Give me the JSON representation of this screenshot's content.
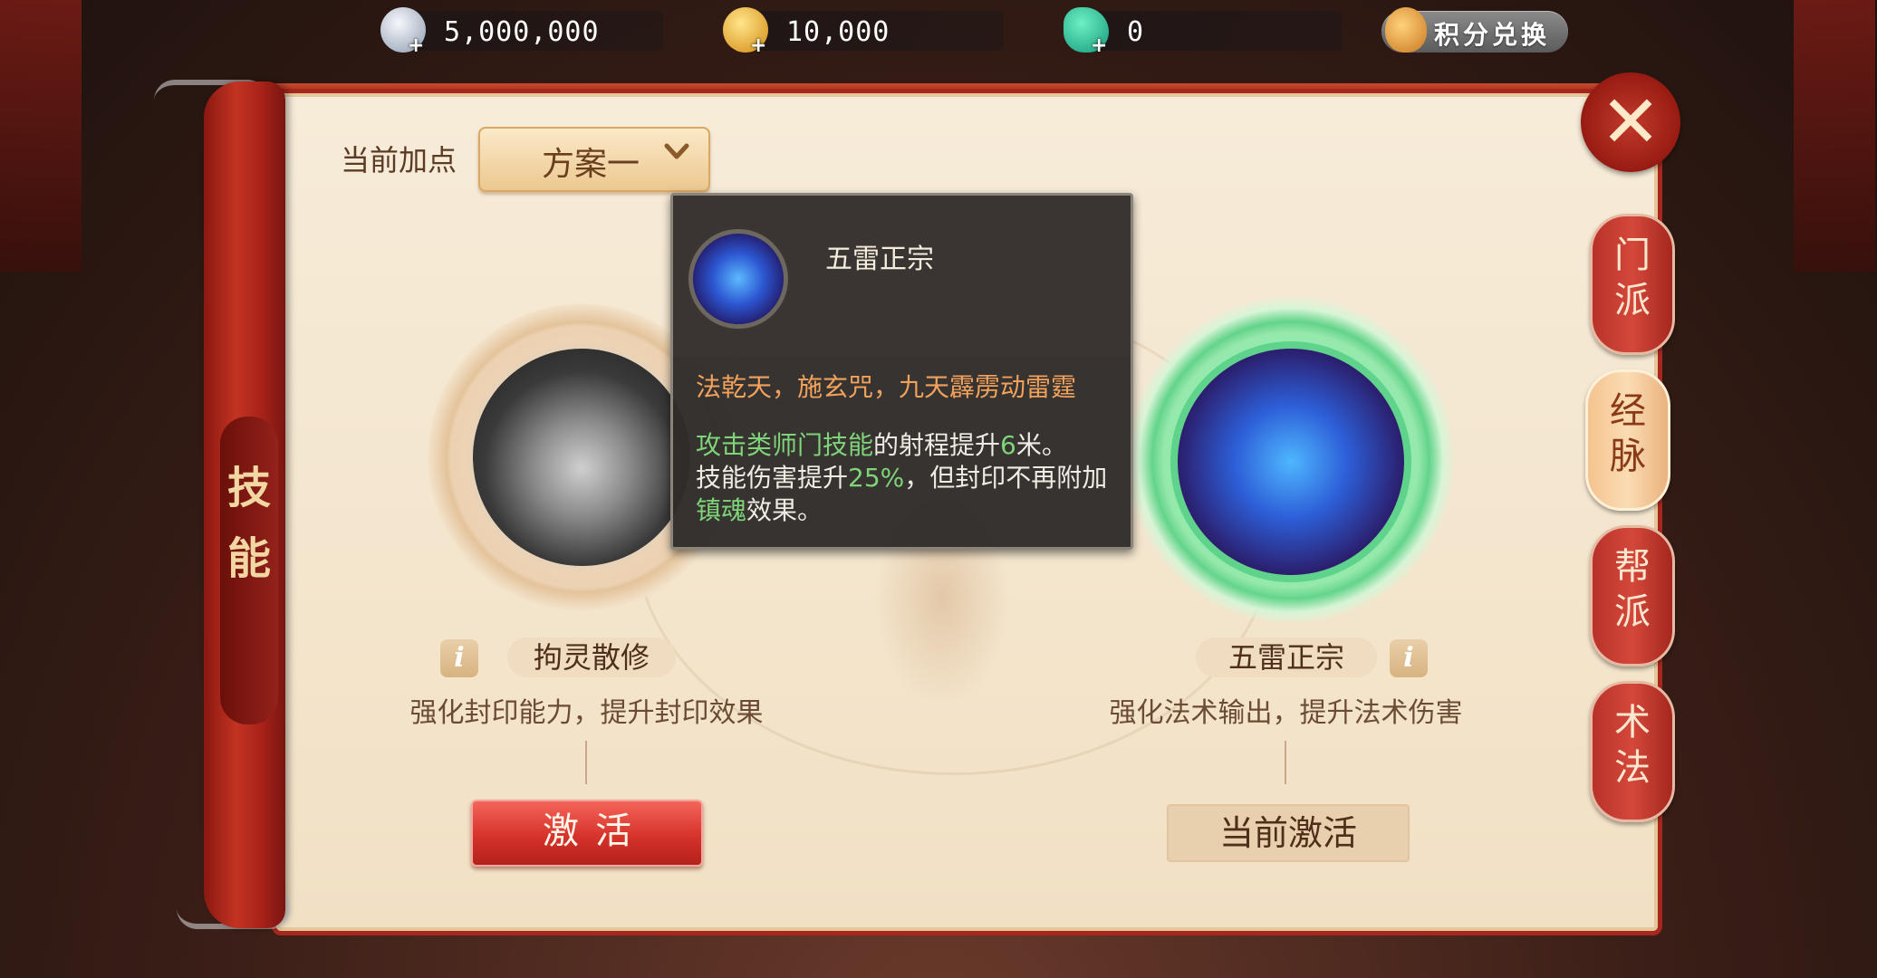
{
  "currency": [
    {
      "icon": "silver-coin-icon",
      "value": "5,000,000",
      "color": "#c8d0dc"
    },
    {
      "icon": "gold-coin-icon",
      "value": "10,000",
      "color": "#f1b52b"
    },
    {
      "icon": "jade-dragon-icon",
      "value": "0",
      "color": "#2ec79a"
    }
  ],
  "exchange_label": "积分兑换",
  "plan": {
    "label": "当前加点",
    "selected": "方案一"
  },
  "scroll_tab": "技能",
  "side_tabs": [
    {
      "label_1": "门",
      "label_2": "派"
    },
    {
      "label_1": "经",
      "label_2": "脉"
    },
    {
      "label_1": "帮",
      "label_2": "派"
    },
    {
      "label_1": "术",
      "label_2": "法"
    }
  ],
  "left_skill": {
    "name": "拘灵散修",
    "desc": "强化封印能力，提升封印效果",
    "button": "激活"
  },
  "right_skill": {
    "name": "五雷正宗",
    "desc": "强化法术输出，提升法术伤害",
    "button": "当前激活"
  },
  "tooltip": {
    "name": "五雷正宗",
    "quote": "法乾天，施玄咒，九天霹雳动雷霆",
    "line1_a": "攻击类师门技能",
    "line1_b": "的射程提升",
    "line1_c": "6",
    "line1_d": "米。",
    "line2_a": "技能伤害提升",
    "line2_b": "25%",
    "line2_c": "，但封印不再附加",
    "line3_a": "镇魂",
    "line3_b": "效果。"
  },
  "info_glyph": "i",
  "close_glyph": "✕"
}
